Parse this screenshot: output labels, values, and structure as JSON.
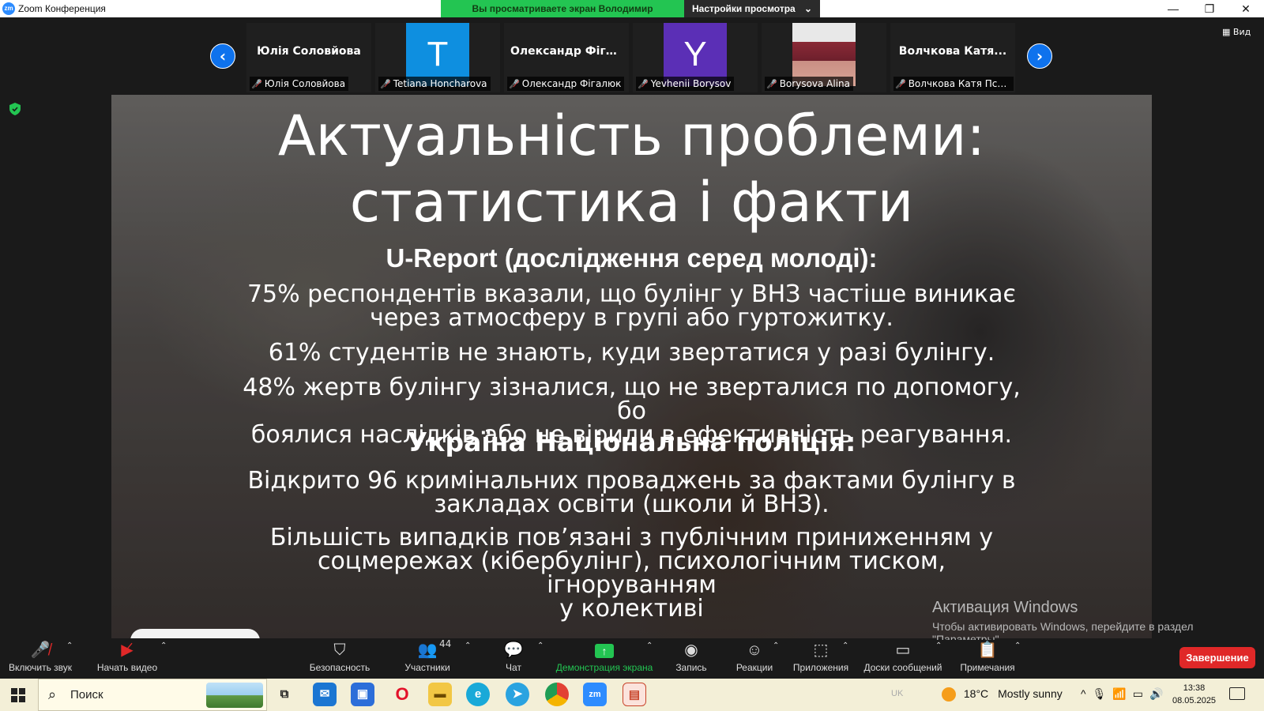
{
  "window": {
    "app_logo": "zm",
    "title": "Zoom Конференция",
    "share_status": "Вы просматриваете экран Володимир Носенко",
    "view_settings_label": "Настройки просмотра",
    "controls": [
      "—",
      "❐",
      "✕"
    ]
  },
  "gallery": {
    "view_label": "Вид",
    "participants": [
      {
        "display": "Юлія Соловйова",
        "label": "Юлія Соловйова",
        "muted": true
      },
      {
        "display": "T",
        "label": "Tetiana Honcharova",
        "muted": true,
        "avatar_color": "#0e8fe0"
      },
      {
        "display": "Олександр Фіга...",
        "label": "Олександр Фігалюк",
        "muted": true
      },
      {
        "display": "Y",
        "label": "Yevhenii Borysov",
        "muted": true,
        "avatar_color": "#5b2fb6"
      },
      {
        "display": "",
        "label": "Borysova Alina",
        "muted": true
      },
      {
        "display": "Волчкова Катя...",
        "label": "Волчкова Катя Псих...",
        "muted": true
      }
    ]
  },
  "slide": {
    "title_line1": "Актуальність проблеми:",
    "title_line2": "статистика і факти",
    "section1_title": "U-Report (дослідження серед молоді):",
    "p1_line1": "75% респондентів вказали, що булінг у ВНЗ частіше виникає",
    "p1_line2": "через атмосферу в групі або гуртожитку.",
    "p2": "61% студентів не знають, куди звертатися у разі булінгу.",
    "p3_line1": "48% жертв булінгу зізналися, що не зверталися по допомогу, бо",
    "p3_line2": "боялися наслідків або не вірили в ефективність реагування.",
    "section2_title": "Україна Національна поліція:",
    "p4_line1": "Відкрито 96 кримінальних проваджень за фактами булінгу в",
    "p4_line2": "закладах освіти (школи й ВНЗ).",
    "p5_line1": "Більшість випадків пов’язані з публічним приниженням у",
    "p5_line2": "соцмережах (кібербулінг), психологічним тиском, ігноруванням",
    "p5_line3": "у колективі"
  },
  "watermark": {
    "line1": "Активация Windows",
    "line2": "Чтобы активировать Windows, перейдите в раздел",
    "line3": "\"Параметры\"."
  },
  "toolbar": {
    "audio": "Включить звук",
    "video": "Начать видео",
    "security": "Безопасность",
    "participants": "Участники",
    "participants_count": "44",
    "chat": "Чат",
    "share": "Демонстрация экрана",
    "record": "Запись",
    "reactions": "Реакции",
    "apps": "Приложения",
    "whiteboards": "Доски сообщений",
    "notes": "Примечания",
    "end": "Завершение"
  },
  "taskbar": {
    "search_placeholder": "Поиск",
    "weather_temp": "18°C",
    "weather_text": "Mostly sunny",
    "lang": "UK",
    "time": "13:38",
    "date": "08.05.2025",
    "apps": [
      "task-view",
      "mail",
      "store",
      "opera",
      "explorer",
      "edge",
      "telegram",
      "chrome",
      "zoom",
      "powerpoint"
    ]
  },
  "colors": {
    "zoom_blue": "#0e72ed",
    "share_green": "#23c552",
    "end_red": "#e02828"
  }
}
